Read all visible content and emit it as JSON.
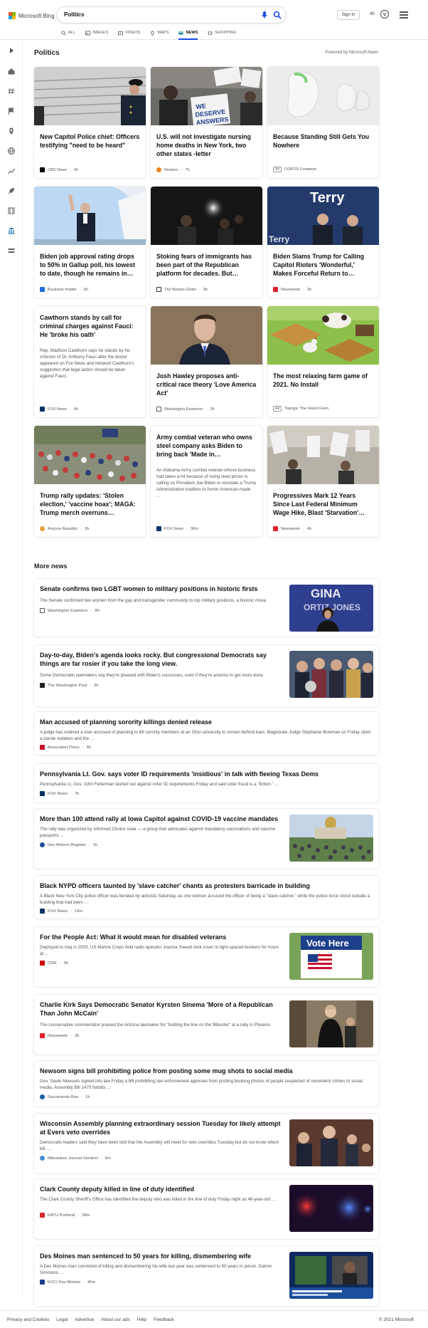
{
  "header": {
    "logo_text": "Microsoft Bing",
    "query": "Politics",
    "signin": "Sign in",
    "points": "40"
  },
  "scopes": [
    {
      "label": "ALL",
      "icon": "search-icon"
    },
    {
      "label": "IMAGES",
      "icon": "image-icon"
    },
    {
      "label": "VIDEOS",
      "icon": "video-icon"
    },
    {
      "label": "MAPS",
      "icon": "map-pin-icon"
    },
    {
      "label": "NEWS",
      "icon": "news-icon",
      "active": true
    },
    {
      "label": "SHOPPING",
      "icon": "shopping-icon"
    }
  ],
  "section": {
    "title": "Politics",
    "powered": "Powered by Microsoft News"
  },
  "cards": [
    {
      "title": "New Capitol Police chief: Officers testifying \"need to be heard\"",
      "source": "CBS News",
      "time": "3h"
    },
    {
      "title": "U.S. will not investigate nursing home deaths in New York, two other states -letter",
      "source": "Reuters",
      "time": "7h"
    },
    {
      "title": "Because Standing Still Gets You Nowhere",
      "ad": "Ad",
      "source": "OOFOS Footwear"
    },
    {
      "title": "Biden job approval rating drops to 50% in Gallup poll, his lowest to date, though he remains in…",
      "source": "Business Insider",
      "time": "5h"
    },
    {
      "title": "Stoking fears of immigrants has been part of the Republican platform for decades. But…",
      "source": "The Boston Globe",
      "time": "5h"
    },
    {
      "title": "Biden Slams Trump for Calling Capitol Rioters 'Wonderful,' Makes Forceful Return to…",
      "source": "Newsweek",
      "time": "2h"
    },
    {
      "title": "Cawthorn stands by call for criminal charges against Fauci: He 'broke his oath'",
      "snippet": "Rep. Madison Cawthorn says he stands by his criticism of Dr. Anthony Fauci after the doctor appeared on Fox News and rebuked Cawthorn's suggestion that legal action should be taken against Fauci.",
      "source": "FOX News",
      "time": "6h"
    },
    {
      "title": "Josh Hawley proposes anti-critical race theory 'Love America Act'",
      "source": "Washington Examiner",
      "time": "2h"
    },
    {
      "title": "The most relaxing farm game of 2021. No Install",
      "ad": "Ad",
      "source": "Taonga: The Island Farm"
    },
    {
      "title": "Trump rally updates: 'Stolen election,' 'vaccine hoax'; MAGA: Trump merch overruns…",
      "source": "Arizona Republic",
      "time": "3h"
    },
    {
      "title": "Army combat veteran who owns steel company asks Biden to bring back 'Made in…",
      "snippet": "An Alabama Army combat veteran whose business had taken a hit because of rising steel prices is calling on President Joe Biden to reinstate a Trump Administration tradition to honor American-made …",
      "source": "FOX News",
      "time": "36m"
    },
    {
      "title": "Progressives Mark 12 Years Since Last Federal Minimum Wage Hike, Blast 'Starvation'…",
      "source": "Newsweek",
      "time": "4h"
    }
  ],
  "more_news": {
    "title": "More news",
    "items": [
      {
        "title": "Senate confirms two LGBT women to military positions in historic firsts",
        "snippet": "The Senate confirmed two women from the gay and transgender community to top military positions, a historic move.",
        "source": "Washington Examiner",
        "time": "8h"
      },
      {
        "title": "Day-to-day, Biden's agenda looks rocky. But congressional Democrats say things are far rosier if you take the long view.",
        "snippet": "Some Democratic lawmakers say they're pleased with Biden's successes, even if they're anxious to get more done.",
        "source": "The Washington Post",
        "time": "2h"
      },
      {
        "title": "Man accused of planning sorority killings denied release",
        "snippet": "A judge has ordered a man accused of planning to kill sorority members at an Ohio university to remain behind bars. Magistrate Judge Stephanie Bowman on Friday cited a parole violation and the …",
        "source": "Associated Press",
        "time": "6h"
      },
      {
        "title": "Pennsylvania Lt. Gov. says voter ID requirements 'insidious' in talk with fleeing Texas Dems",
        "snippet": "Pennsylvania Lt. Gov. John Fetterman lashed out against voter ID requirements Friday and said voter fraud is a \"fiction.\" …",
        "source": "FOX News",
        "time": "7h"
      },
      {
        "title": "More than 100 attend rally at Iowa Capitol against COVID-19 vaccine mandates",
        "snippet": "The rally was organized by Informed Choice Iowa — a group that advocates against mandatory vaccinations and vaccine passports …",
        "source": "Des Moines Register",
        "time": "1h"
      },
      {
        "title": "Black NYPD officers taunted by 'slave catcher' chants as protesters barricade in building",
        "snippet": "A Black New York City police officer was berated by activists Saturday, as one woman accused the officer of being a \"slave catcher,\" while the police force stood outside a building that had been …",
        "source": "FOX News",
        "time": "15m"
      },
      {
        "title": "For the People Act: What it would mean for disabled veterans",
        "snippet": "Deployed to Iraq in 2003, US Marine Corps field radio operator Joanna Sweatt took cover in tight-spaced bunkers for hours at …",
        "source": "CNN",
        "time": "3h"
      },
      {
        "title": "Charlie Kirk Says Democratic Senator Kyrsten Sinema 'More of a Republican Than John McCain'",
        "snippet": "The conservative commentator praised the Arizona lawmaker for \"holding the line on the filibuster\" at a rally in Phoenix.",
        "source": "Newsweek",
        "time": "3h"
      },
      {
        "title": "Newsom signs bill prohibiting police from posting some mug shots to social media",
        "snippet": "Gov. Gavin Newsom signed into law Friday a bill prohibiting law enforcement agencies from posting booking photos of people suspected of nonviolent crimes to social media. Assembly Bill 1475 forbids …",
        "source": "Sacramento Bee",
        "time": "1h"
      },
      {
        "title": "Wisconsin Assembly planning extraordinary session Tuesday for likely attempt at Evers veto overrides",
        "snippet": "Democratic leaders said they have been told that the Assembly will meet for veto overrides Tuesday but do not know which bill …",
        "source": "Milwaukee Journal-Sentinel",
        "time": "6m"
      },
      {
        "title": "Clark County deputy killed in line of duty identified",
        "snippet": "The Clark County Sheriff's Office has identified the deputy who was killed in the line of duty Friday night as 46-year-old …",
        "source": "KATU Portland",
        "time": "38m"
      },
      {
        "title": "Des Moines man sentenced to 50 years for killing, dismembering wife",
        "snippet": "A Des Moines man convicted of killing and dismembering his wife last year was sentenced to 50 years in prison. Datron Simmons …",
        "source": "KCCI Des Moines",
        "time": "40m"
      }
    ]
  },
  "image_text": {
    "deserve": "WE DESERVE ANSWERS",
    "terry": "Terry",
    "gina": "GINA ORTIZ JONES",
    "vote": "Vote Here"
  },
  "footer": {
    "links": [
      "Privacy and Cookies",
      "Legal",
      "Advertise",
      "About our ads",
      "Help",
      "Feedback"
    ],
    "copyright": "© 2021 Microsoft"
  },
  "colors": {
    "accent": "#174ae4",
    "text": "#111111",
    "muted": "#555555"
  }
}
